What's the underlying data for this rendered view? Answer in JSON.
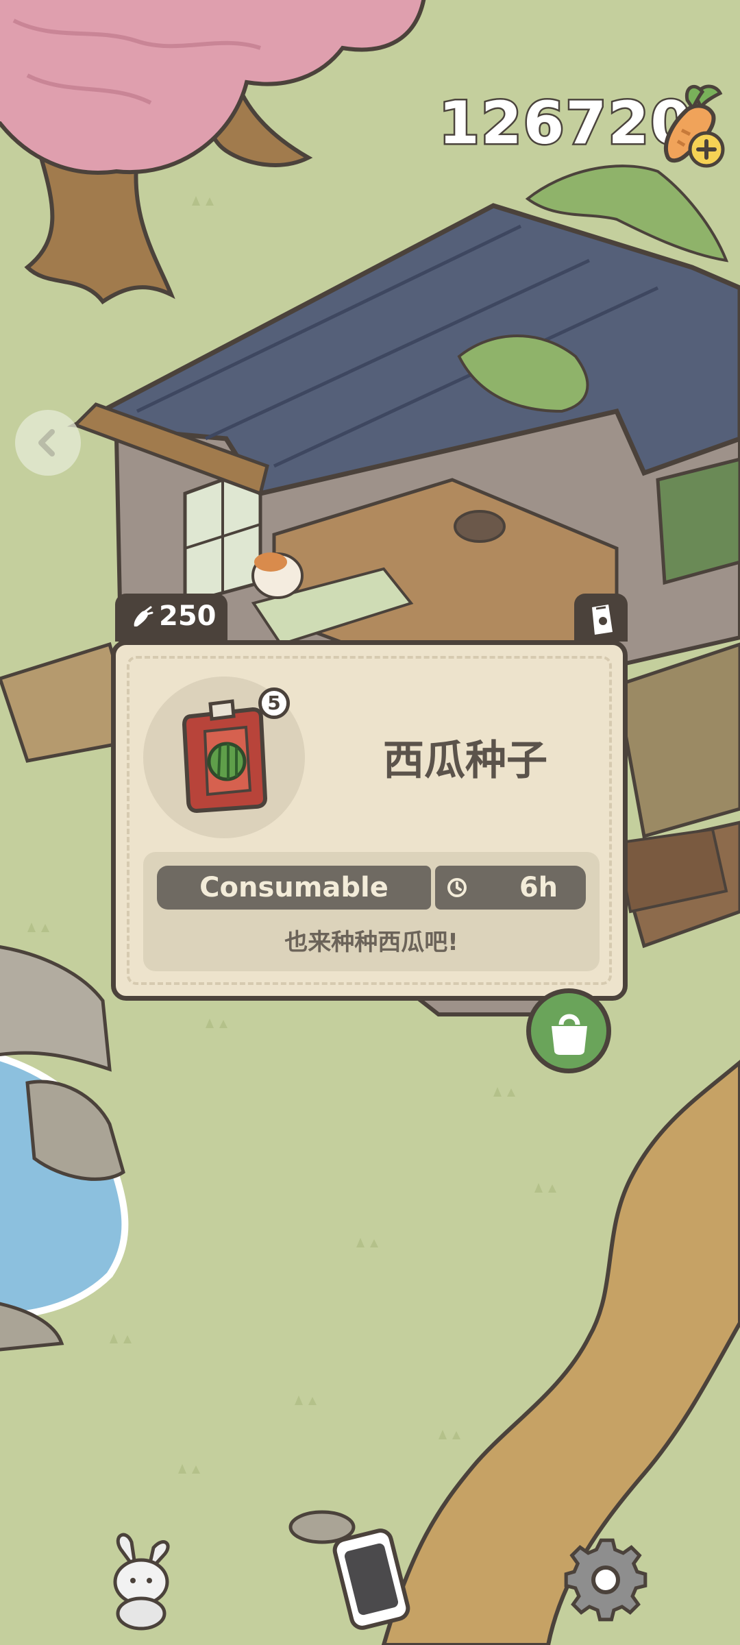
{
  "hud": {
    "carrot_balance": "126720",
    "carrot_plus_icon": "carrot-plus-icon",
    "back_icon": "chevron-left-icon"
  },
  "popup": {
    "price": "250",
    "price_icon": "carrot-icon",
    "bag_tab_icon": "seed-bag-icon",
    "item_name": "西瓜种子",
    "item_icon": "watermelon-seed-packet-icon",
    "quantity": "5",
    "type": "Consumable",
    "time_icon": "clock-icon",
    "grow_time": "6h",
    "description": "也来种种西瓜吧!"
  },
  "shop_button_icon": "shopping-bag-icon",
  "nav": {
    "left_icon": "bunny-plush-icon",
    "center_icon": "phone-icon",
    "right_icon": "gear-icon"
  },
  "colors": {
    "grass": "#c4cf9d",
    "panel": "#ede3cc",
    "panel_border": "#4b423b",
    "pill": "#6f6a62",
    "shop_button": "#6aa45a"
  }
}
